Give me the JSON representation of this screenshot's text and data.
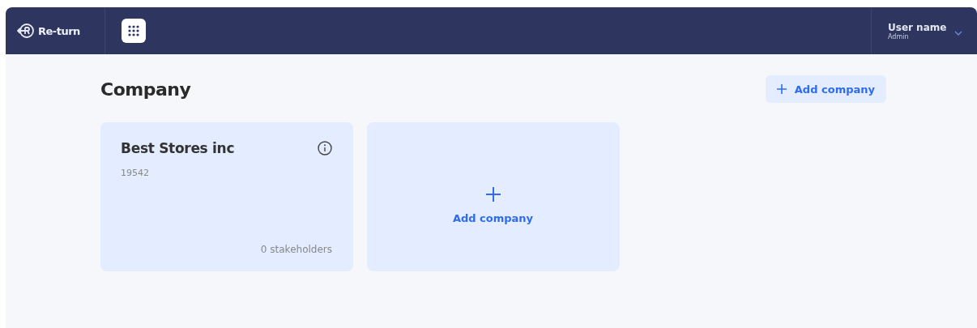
{
  "header": {
    "logo": "Re-turn",
    "user": {
      "name": "User name",
      "role": "Admin"
    }
  },
  "page": {
    "title": "Company",
    "add_button": "Add company"
  },
  "companies": [
    {
      "name": "Best Stores inc",
      "number": "19542",
      "stakeholders": "0 stakeholders"
    }
  ],
  "add_card": {
    "label": "Add company"
  }
}
